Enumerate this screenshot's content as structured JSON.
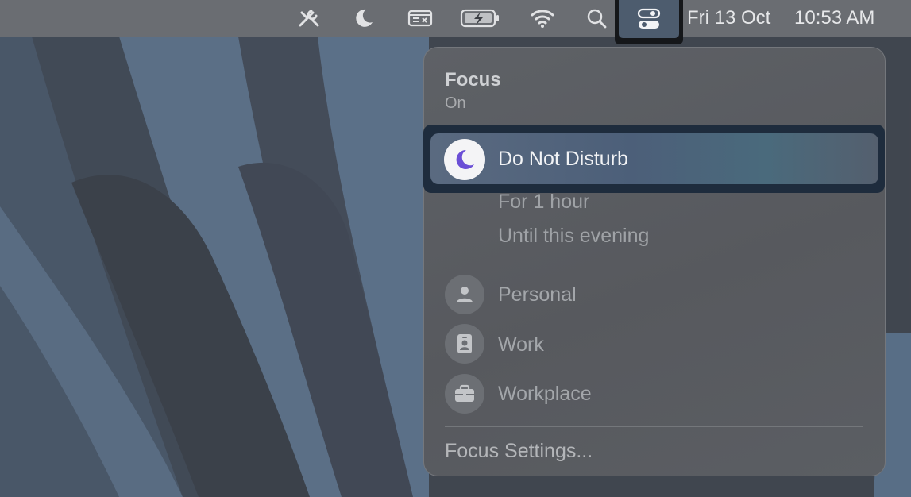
{
  "menubar": {
    "icons": [
      "tools-icon",
      "moon-icon",
      "display-icon",
      "battery-charging-icon",
      "wifi-icon",
      "search-icon",
      "control-center-icon"
    ],
    "date": "Fri 13 Oct",
    "time": "10:53 AM"
  },
  "focus": {
    "title": "Focus",
    "state": "On",
    "dnd_label": "Do Not Disturb",
    "dnd_options": [
      "For 1 hour",
      "Until this evening"
    ],
    "modes": [
      {
        "label": "Personal",
        "icon": "person-icon"
      },
      {
        "label": "Work",
        "icon": "id-badge-icon"
      },
      {
        "label": "Workplace",
        "icon": "briefcase-icon"
      }
    ],
    "settings_label": "Focus Settings..."
  },
  "colors": {
    "menubar": "#6a6d72",
    "panel": "#5b5e63",
    "dnd_accent": "#6b4fd6"
  }
}
